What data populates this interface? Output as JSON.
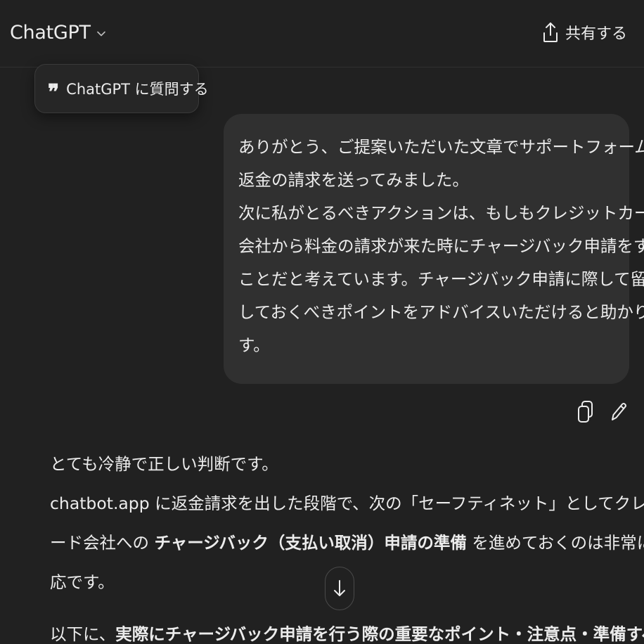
{
  "header": {
    "model_name": "ChatGPT",
    "share_label": "共有する"
  },
  "ask_popup": {
    "quote_glyph": "❞",
    "label": "ChatGPT に質問する"
  },
  "user_message": {
    "lines": [
      "ありがとう、ご提案いただいた文章でサポートフォームへ",
      "返金の請求を送ってみました。",
      "次に私がとるべきアクションは、もしもクレジットカード",
      "会社から料金の請求が来た時にチャージバック申請をする",
      "ことだと考えています。チャージバック申請に際して留意",
      "しておくべきポイントをアドバイスいただけると助かりま",
      "す。"
    ]
  },
  "assistant_message": {
    "line1": "とても冷静で正しい判断です。",
    "line2": "chatbot.app に返金請求を出した段階で、次の「セーフティネット」としてクレジットカ",
    "line3_pre": "ード会社への ",
    "line3_bold": "チャージバック（支払い取消）申請の準備",
    "line3_post": " を進めておくのは非常に良い対",
    "line4": "応です。",
    "line5_pre": "以下に、",
    "line5_bold": "実際にチャージバック申請を行う際の重要なポイント・注意点・準備すべき証拠"
  },
  "icons": {
    "chevron": "chevron-down-icon",
    "share": "share-icon",
    "copy": "copy-icon",
    "edit": "pencil-icon",
    "scroll": "arrow-down-icon"
  },
  "colors": {
    "background": "#212121",
    "bubble": "#303030",
    "text": "#ececec"
  }
}
